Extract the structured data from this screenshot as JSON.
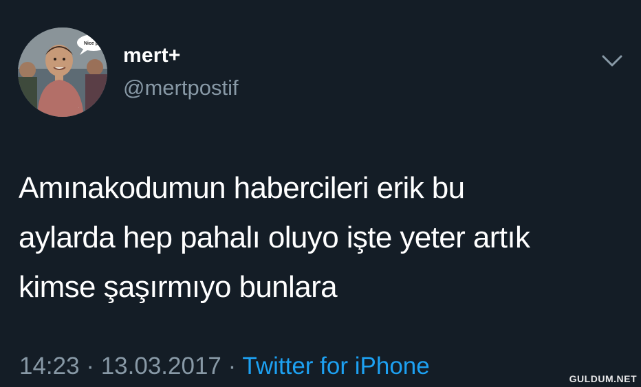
{
  "user": {
    "name": "mert+",
    "handle": "@mertpostif",
    "avatar_bubble_text": "Nice p"
  },
  "tweet": {
    "lines": [
      "Amınakodumun habercileri erik bu",
      "aylarda hep pahalı oluyo işte yeter artık",
      "kimse şaşırmıyo bunlara"
    ],
    "time": "14:23",
    "separator": "·",
    "date": "13.03.2017",
    "source": "Twitter for iPhone"
  },
  "watermark": "GULDUM.NET",
  "colors": {
    "background": "#141d26",
    "primary_text": "#ffffff",
    "secondary_text": "#8899a6",
    "link": "#1da1f2"
  },
  "icons": {
    "more_menu": "chevron-down-icon"
  }
}
